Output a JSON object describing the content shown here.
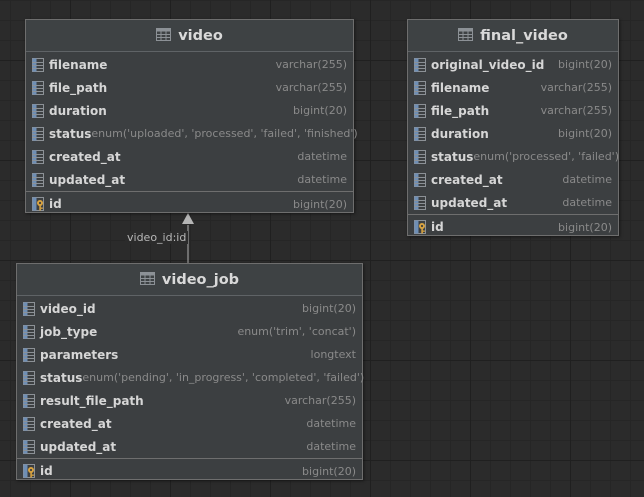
{
  "tables": {
    "video": {
      "title": "video",
      "columns": [
        {
          "name": "filename",
          "type": "varchar(255)"
        },
        {
          "name": "file_path",
          "type": "varchar(255)"
        },
        {
          "name": "duration",
          "type": "bigint(20)"
        },
        {
          "name": "status",
          "type": "enum('uploaded', 'processed', 'failed', 'finished')"
        },
        {
          "name": "created_at",
          "type": "datetime"
        },
        {
          "name": "updated_at",
          "type": "datetime"
        }
      ],
      "pk": {
        "name": "id",
        "type": "bigint(20)"
      }
    },
    "final_video": {
      "title": "final_video",
      "columns": [
        {
          "name": "original_video_id",
          "type": "bigint(20)"
        },
        {
          "name": "filename",
          "type": "varchar(255)"
        },
        {
          "name": "file_path",
          "type": "varchar(255)"
        },
        {
          "name": "duration",
          "type": "bigint(20)"
        },
        {
          "name": "status",
          "type": "enum('processed', 'failed')"
        },
        {
          "name": "created_at",
          "type": "datetime"
        },
        {
          "name": "updated_at",
          "type": "datetime"
        }
      ],
      "pk": {
        "name": "id",
        "type": "bigint(20)"
      }
    },
    "video_job": {
      "title": "video_job",
      "columns": [
        {
          "name": "video_id",
          "type": "bigint(20)"
        },
        {
          "name": "job_type",
          "type": "enum('trim', 'concat')"
        },
        {
          "name": "parameters",
          "type": "longtext"
        },
        {
          "name": "status",
          "type": "enum('pending', 'in_progress', 'completed', 'failed')"
        },
        {
          "name": "result_file_path",
          "type": "varchar(255)"
        },
        {
          "name": "created_at",
          "type": "datetime"
        },
        {
          "name": "updated_at",
          "type": "datetime"
        }
      ],
      "pk": {
        "name": "id",
        "type": "bigint(20)"
      }
    }
  },
  "relation": {
    "label": "video_id:id"
  },
  "colors": {
    "icon_blue": "#6f8fb5",
    "icon_gray": "#8c9196",
    "key_gold": "#d9a441",
    "arrow": "#b5b5b5"
  }
}
